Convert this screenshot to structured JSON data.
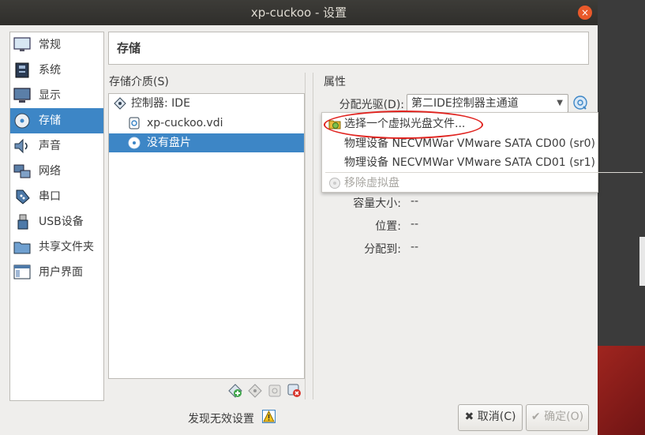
{
  "window": {
    "title": "xp-cuckoo - 设置",
    "close_glyph": "×"
  },
  "sidebar": {
    "items": [
      {
        "label": "常规",
        "icon": "general-icon"
      },
      {
        "label": "系统",
        "icon": "system-icon"
      },
      {
        "label": "显示",
        "icon": "display-icon"
      },
      {
        "label": "存储",
        "icon": "storage-icon",
        "active": true
      },
      {
        "label": "声音",
        "icon": "audio-icon"
      },
      {
        "label": "网络",
        "icon": "network-icon"
      },
      {
        "label": "串口",
        "icon": "serial-port-icon"
      },
      {
        "label": "USB设备",
        "icon": "usb-icon"
      },
      {
        "label": "共享文件夹",
        "icon": "shared-folder-icon"
      },
      {
        "label": "用户界面",
        "icon": "user-interface-icon"
      }
    ]
  },
  "header": {
    "title": "存储"
  },
  "storage": {
    "label": "存储介质(S)",
    "tree": [
      {
        "label": "控制器: IDE",
        "icon": "controller-icon"
      },
      {
        "label": "xp-cuckoo.vdi",
        "icon": "hard-disk-icon"
      },
      {
        "label": "没有盘片",
        "icon": "optical-disk-icon",
        "selected": true
      }
    ]
  },
  "properties": {
    "label": "属性",
    "drive_label": "分配光驱(D):",
    "drive_value": "第二IDE控制器主通道",
    "size_label": "容量大小:",
    "size_value": "--",
    "location_label": "位置:",
    "location_value": "--",
    "attached_label": "分配到:",
    "attached_value": "--"
  },
  "dropdown": {
    "items": [
      {
        "label": "选择一个虚拟光盘文件..."
      },
      {
        "label": "物理设备 NECVMWar VMware SATA CD00 (sr0)"
      },
      {
        "label": "物理设备 NECVMWar VMware SATA CD01 (sr1)"
      },
      {
        "label": "移除虚拟盘",
        "disabled": true
      }
    ]
  },
  "footer": {
    "warning_text": "发现无效设置",
    "cancel_label": "取消(C)",
    "ok_label": "确定(O)"
  },
  "colors": {
    "accent": "#3d86c6",
    "highlight": "#e0231f",
    "titlebar": "#2f2e2b",
    "close": "#e9592a"
  }
}
